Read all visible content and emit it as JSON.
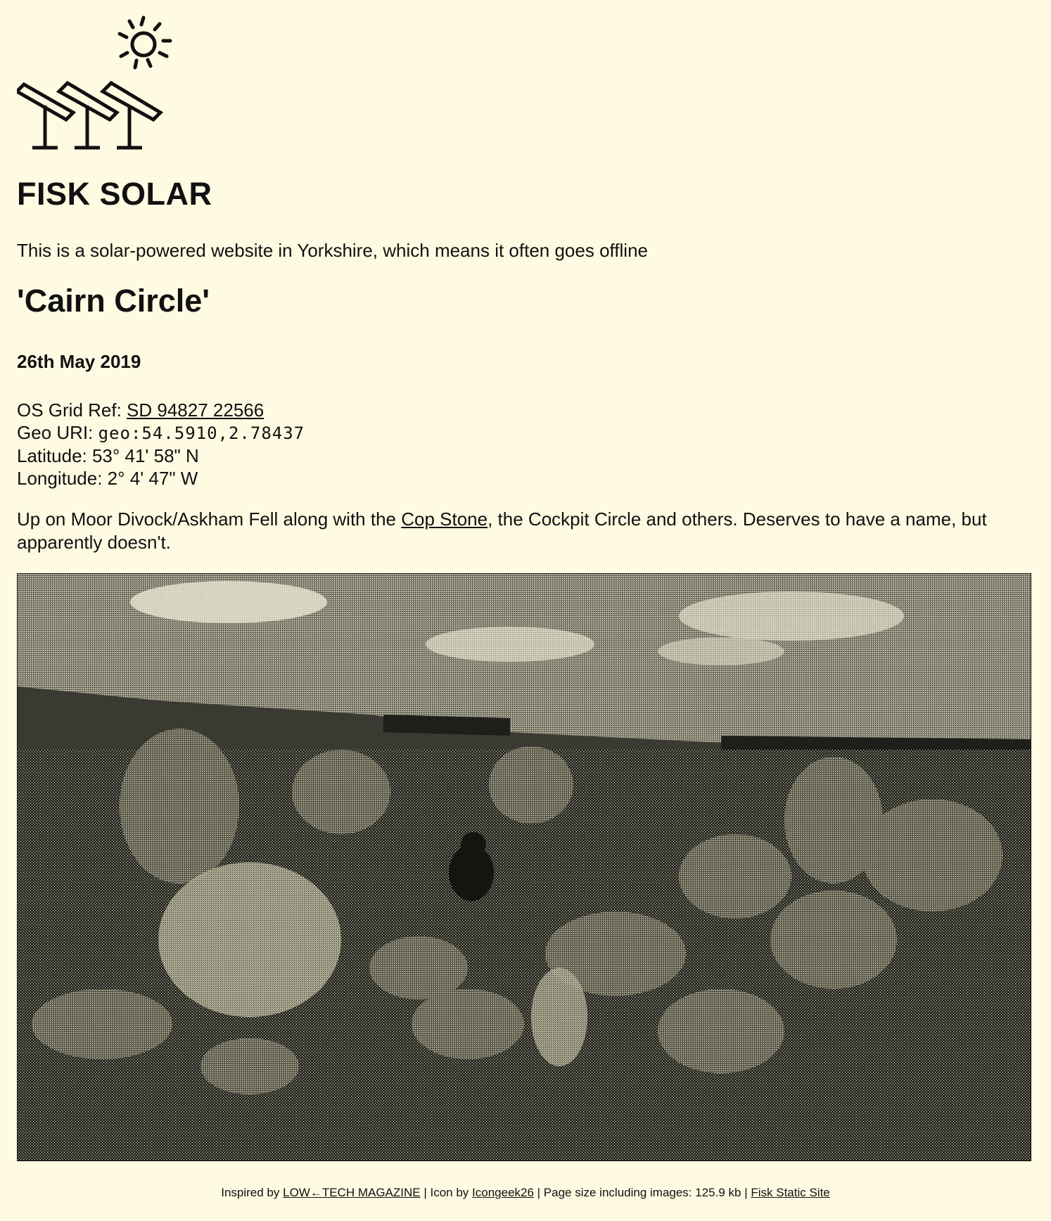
{
  "header": {
    "site_title": "FISK SOLAR",
    "tagline": "This is a solar-powered website in Yorkshire, which means it often goes offline",
    "logo_icon": "solar-panels-sun-icon"
  },
  "post": {
    "title": "'Cairn Circle'",
    "date": "26th May 2019",
    "grid_ref_label": "OS Grid Ref: ",
    "grid_ref_value": "SD 94827 22566",
    "geo_uri_label": "Geo URI: ",
    "geo_uri_value": "geo:54.5910,2.78437",
    "latitude": "Latitude: 53° 41' 58\" N",
    "longitude": "Longitude: 2° 4' 47\" W",
    "desc_before_link": "Up on Moor Divock/Askham Fell along with the ",
    "desc_link": "Cop Stone",
    "desc_after_link": ", the Cockpit Circle and others. Deserves to have a name, but apparently doesn't.",
    "photo_description_icon": "dithered-photo"
  },
  "footer": {
    "inspired_by": "Inspired by ",
    "ltm_link": "LOW←TECH MAGAZINE",
    "icon_by": " | Icon by ",
    "icon_author_link": "Icongeek26",
    "page_size": " | Page size including images: 125.9 kb | ",
    "static_site_link": "Fisk Static Site"
  },
  "colors": {
    "background": "#fefbe2",
    "text": "#111111"
  }
}
